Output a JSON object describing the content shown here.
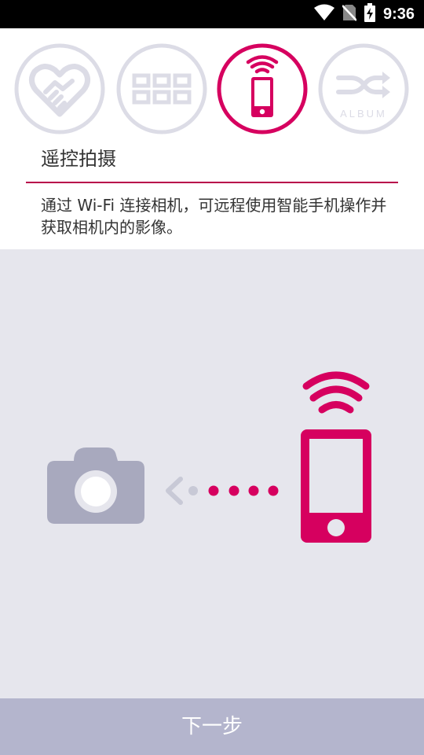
{
  "status_bar": {
    "time": "9:36"
  },
  "steps": [
    {
      "name": "handshake",
      "label": ""
    },
    {
      "name": "grid",
      "label": ""
    },
    {
      "name": "remote",
      "label": ""
    },
    {
      "name": "album",
      "label": "ALBUM"
    }
  ],
  "content": {
    "title": "遥控拍摄",
    "description": "通过 Wi-Fi 连接相机，可远程使用智能手机操作并获取相机内的影像。"
  },
  "footer": {
    "next_label": "下一步"
  },
  "colors": {
    "accent": "#d6005f",
    "inactive": "#dcdce6",
    "camera": "#a8a9be",
    "illustration_bg": "#e6e6ed",
    "button_bg": "#b4b5cd"
  }
}
